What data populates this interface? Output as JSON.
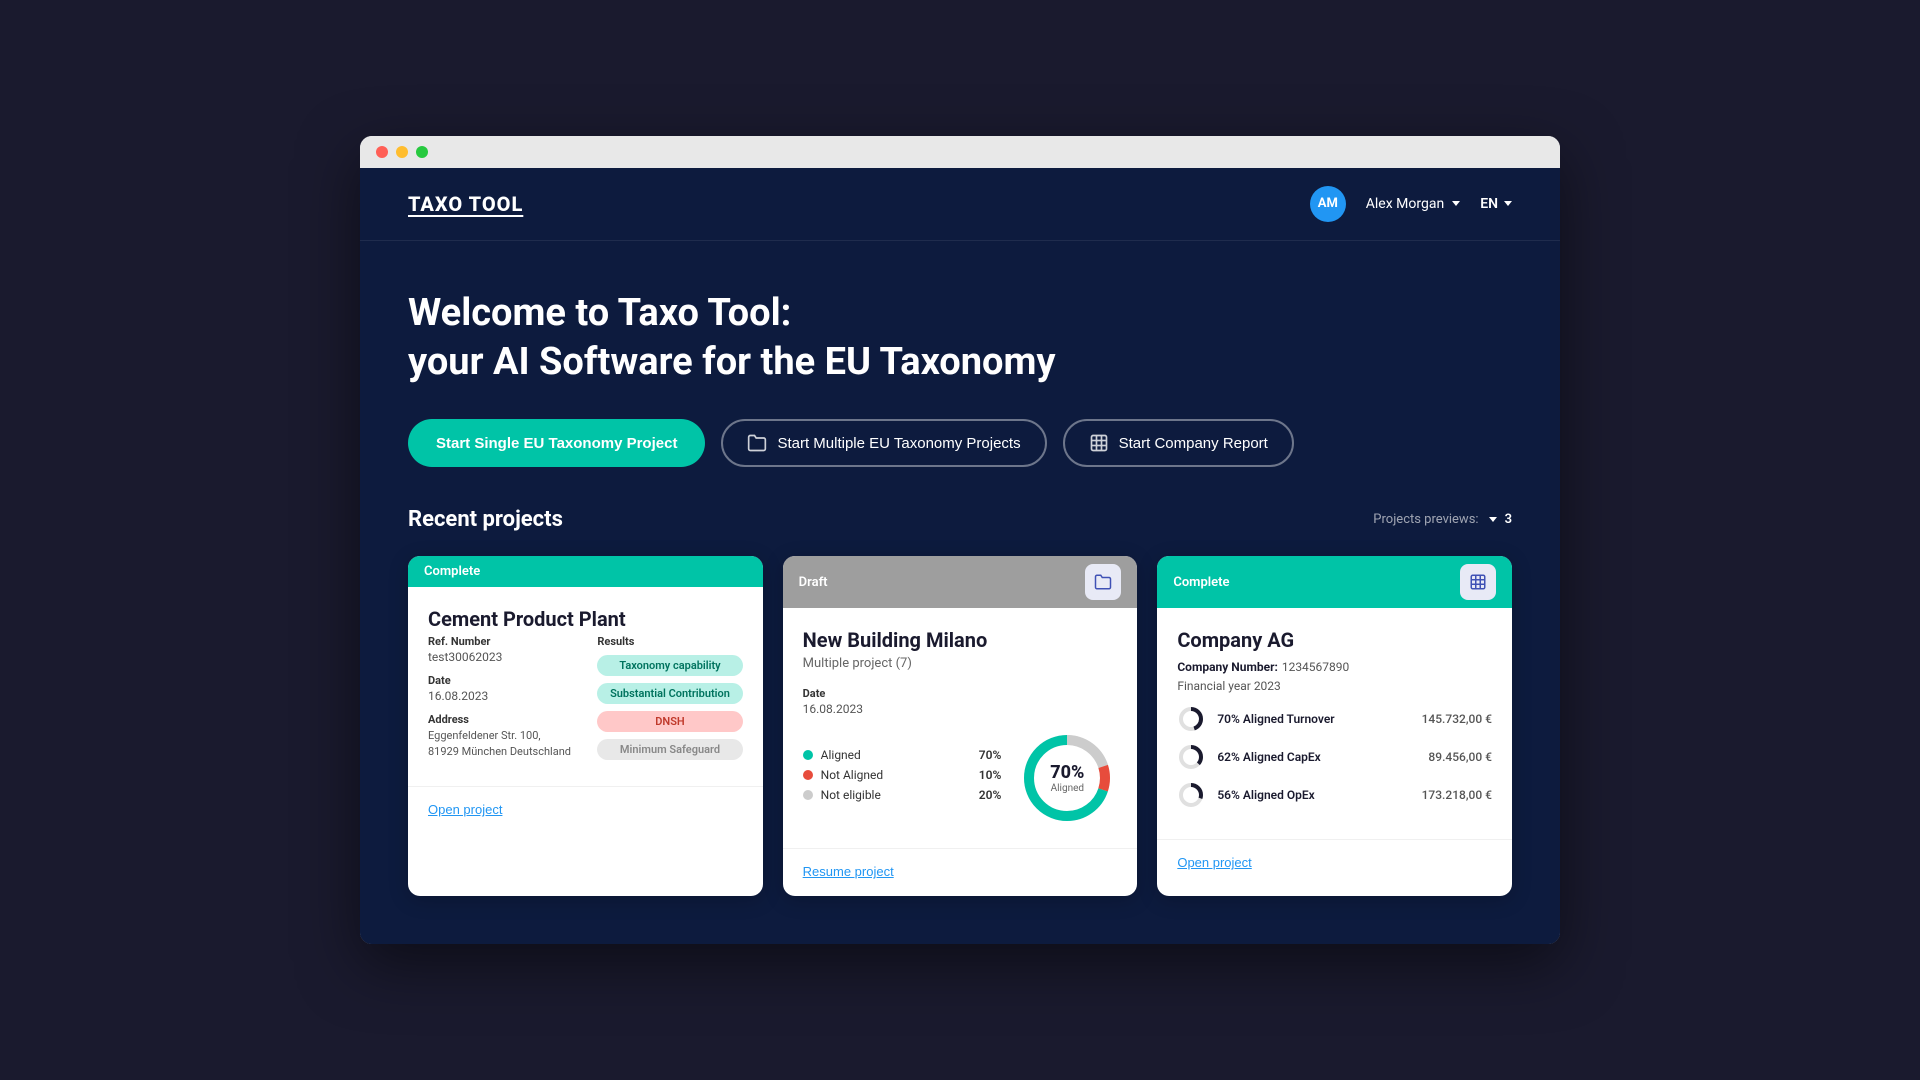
{
  "browser": {
    "traffic_lights": [
      "red",
      "yellow",
      "green"
    ]
  },
  "header": {
    "logo": "TAXO TOOL",
    "user": {
      "initials": "AM",
      "name": "Alex Morgan"
    },
    "language": "EN"
  },
  "hero": {
    "title_line1": "Welcome to Taxo Tool:",
    "title_line2": "your AI Software for the EU Taxonomy",
    "buttons": {
      "single": "Start Single EU Taxonomy Project",
      "multiple": "Start Multiple EU Taxonomy Projects",
      "company": "Start Company Report"
    }
  },
  "recent": {
    "section_title": "Recent projects",
    "preview_label": "Projects previews:",
    "preview_count": "3",
    "projects": [
      {
        "id": "card-1",
        "status": "Complete",
        "status_type": "complete",
        "title": "Cement Product Plant",
        "ref_label": "Ref. Number",
        "ref_value": "test30062023",
        "date_label": "Date",
        "date_value": "16.08.2023",
        "address_label": "Address",
        "address_value": "Eggenfeldener Str. 100, 81929 München Deutschland",
        "results_label": "Results",
        "tags": [
          {
            "label": "Taxonomy capability",
            "type": "taxonomy"
          },
          {
            "label": "Substantial Contribution",
            "type": "substantial"
          },
          {
            "label": "DNSH",
            "type": "dnsh"
          },
          {
            "label": "Minimum Safeguard",
            "type": "minimum"
          }
        ],
        "action_label": "Open project",
        "card_type": "single",
        "icon": "📄"
      },
      {
        "id": "card-2",
        "status": "Draft",
        "status_type": "draft",
        "title": "New Building Milano",
        "subtitle": "Multiple project (7)",
        "date_label": "Date",
        "date_value": "16.08.2023",
        "chart": {
          "aligned_pct": 70,
          "not_aligned_pct": 10,
          "not_eligible_pct": 20,
          "center_value": "70%",
          "center_label": "Aligned"
        },
        "legend": [
          {
            "label": "Aligned",
            "pct": "70%",
            "color": "#00c4a7"
          },
          {
            "label": "Not Aligned",
            "pct": "10%",
            "color": "#e74c3c"
          },
          {
            "label": "Not eligible",
            "pct": "20%",
            "color": "#ccc"
          }
        ],
        "action_label": "Resume project",
        "card_type": "multiple",
        "icon": "📁"
      },
      {
        "id": "card-3",
        "status": "Complete",
        "status_type": "complete",
        "title": "Company AG",
        "company_number_label": "Company Number:",
        "company_number_value": "1234567890",
        "financial_year": "Financial year 2023",
        "metrics": [
          {
            "label": "70%  Aligned Turnover",
            "value": "145.732,00 €",
            "pct": 70
          },
          {
            "label": "62%  Aligned CapEx",
            "value": "89.456,00 €",
            "pct": 62
          },
          {
            "label": "56%  Aligned OpEx",
            "value": "173.218,00 €",
            "pct": 56
          }
        ],
        "action_label": "Open project",
        "card_type": "company",
        "icon": "📊"
      }
    ]
  }
}
